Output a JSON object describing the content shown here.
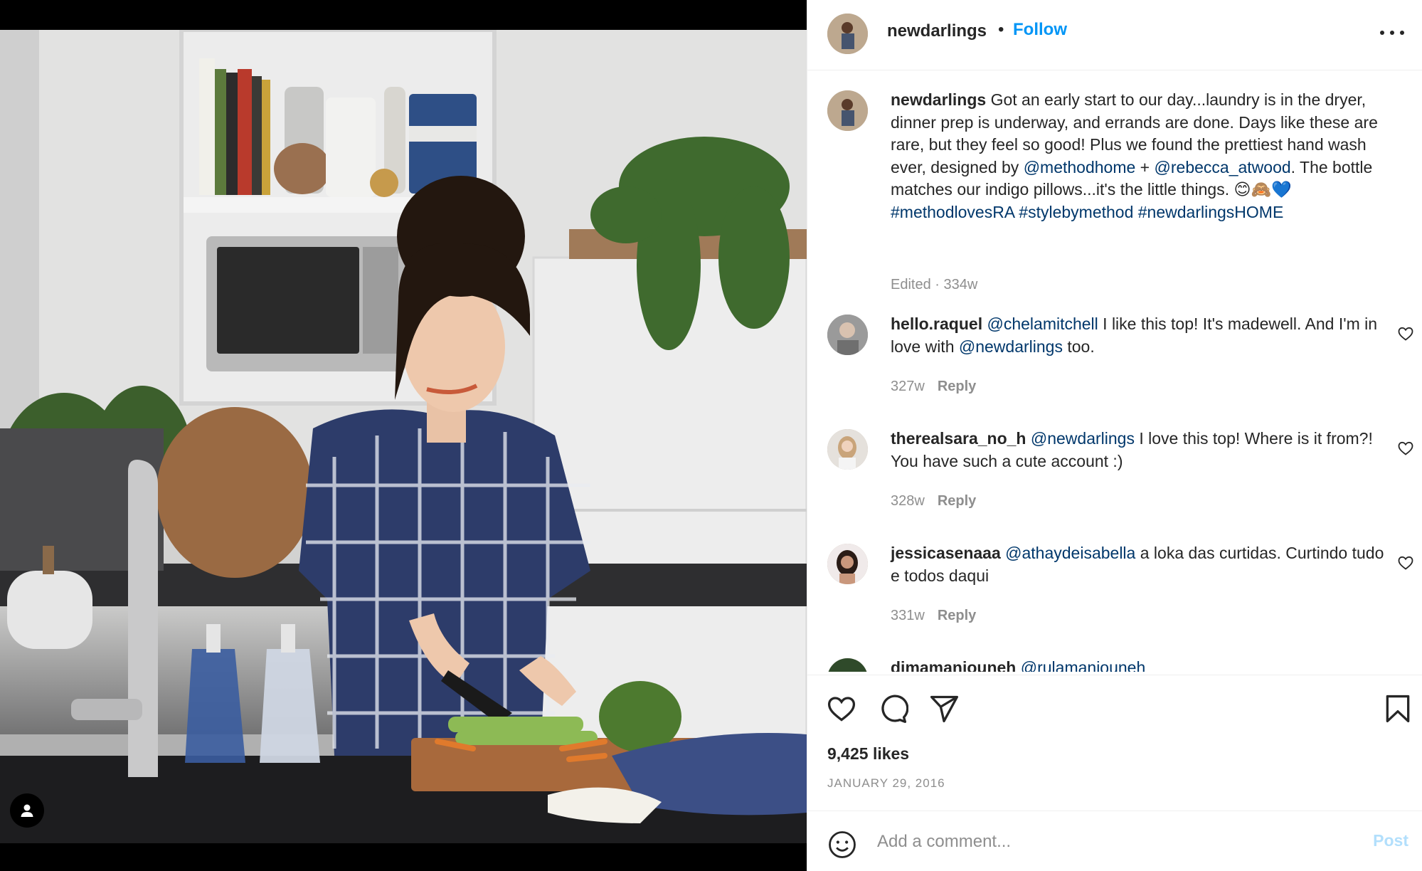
{
  "post": {
    "author": "newdarlings",
    "follow_label": "Follow",
    "separator": "•",
    "caption": {
      "user": "newdarlings",
      "parts": [
        " Got an early start to our day...laundry is in the dryer, dinner prep is underway, and errands are done. Days like these are rare, but they feel so good! Plus we found the prettiest hand wash ever, designed by ",
        "@methodhome",
        " + ",
        "@rebecca_atwood",
        ". The bottle matches our indigo pillows...it's the little things. 😊🙈💙 ",
        "#methodlovesRA",
        " ",
        "#stylebymethod",
        " ",
        "#newdarlingsHOME"
      ],
      "meta": "Edited · 334w"
    },
    "comments": [
      {
        "user": "hello.raquel",
        "mention": "@chelamitchell",
        "text1": " I like this top! It's madewell. And I'm in love with ",
        "mention2": "@newdarlings",
        "text2": " too.",
        "age": "327w",
        "reply_label": "Reply"
      },
      {
        "user": "therealsara_no_h",
        "mention": "@newdarlings",
        "text1": " I love this top! Where is it from?! You have such a cute account :)",
        "age": "328w",
        "reply_label": "Reply"
      },
      {
        "user": "jessicasenaaa",
        "mention": "@athaydeisabella",
        "text1": " a loka das curtidas. Curtindo tudo e todos daqui",
        "age": "331w",
        "reply_label": "Reply"
      },
      {
        "user": "dimamaniouneh",
        "mention": "@rulamaniouneh",
        "text1": ""
      }
    ],
    "likes": "9,425 likes",
    "date": "JANUARY 29, 2016",
    "composer": {
      "placeholder": "Add a comment...",
      "post_label": "Post"
    }
  },
  "icons": {
    "more": "more-options-icon",
    "like": "heart-icon",
    "comment": "comment-icon",
    "share": "paper-plane-icon",
    "save": "bookmark-icon",
    "emoji": "emoji-icon",
    "tag": "user-tag-icon"
  },
  "colors": {
    "accent": "#0095f6",
    "link": "#00376b",
    "muted": "#8e8e8e",
    "post_disabled": "#b2dffc"
  }
}
